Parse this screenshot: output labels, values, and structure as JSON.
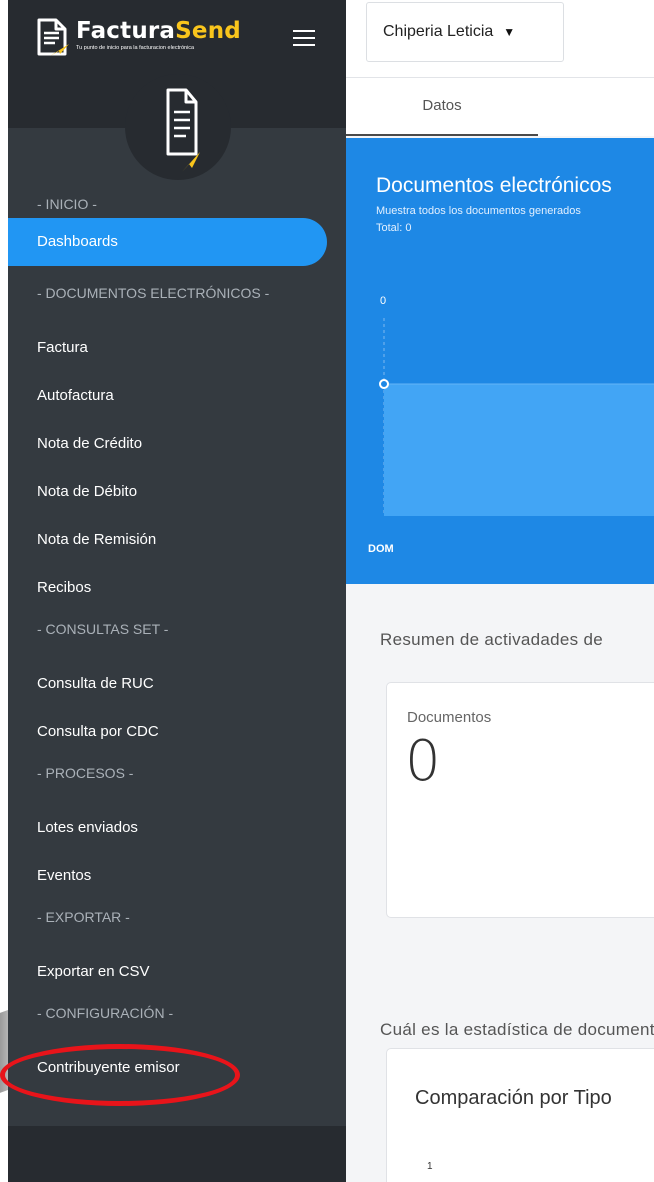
{
  "app": {
    "brand_part1": "Factura",
    "brand_part2": "Send",
    "tagline": "Tu punto de inicio para la facturacion electrónica",
    "brand_accent_color": "#f9c51c",
    "sidebar_bg": "#343a40",
    "active_color": "#2196f3"
  },
  "sidebar": {
    "sections": [
      {
        "header": "- INICIO -",
        "items": [
          {
            "label": "Dashboards",
            "active": true
          }
        ]
      },
      {
        "header": "- DOCUMENTOS ELECTRÓNICOS -",
        "items": [
          {
            "label": "Factura"
          },
          {
            "label": "Autofactura"
          },
          {
            "label": "Nota de Crédito"
          },
          {
            "label": "Nota de Débito"
          },
          {
            "label": "Nota de Remisión"
          },
          {
            "label": "Recibos"
          }
        ]
      },
      {
        "header": "- CONSULTAS SET -",
        "items": [
          {
            "label": "Consulta de RUC"
          },
          {
            "label": "Consulta por CDC"
          }
        ]
      },
      {
        "header": "- PROCESOS -",
        "items": [
          {
            "label": "Lotes enviados"
          },
          {
            "label": "Eventos"
          }
        ]
      },
      {
        "header": "- EXPORTAR -",
        "items": [
          {
            "label": "Exportar en CSV"
          }
        ]
      },
      {
        "header": "- CONFIGURACIÓN -",
        "items": [
          {
            "label": "Contribuyente emisor",
            "highlighted": true
          }
        ]
      }
    ]
  },
  "topbar": {
    "company": "Chiperia Leticia"
  },
  "tabs": [
    {
      "label": "Datos",
      "active": true
    }
  ],
  "documents_chart": {
    "title": "Documentos electrónicos",
    "subtitle": "Muestra todos los documentos generados",
    "total": "Total: 0",
    "bg_color": "#1e88e5",
    "chart_data": {
      "type": "area",
      "categories": [
        "DOM"
      ],
      "values": [
        0
      ],
      "ylim": [
        0,
        0
      ],
      "ytick_labels": [
        "0"
      ],
      "xtick_labels": [
        "DOM"
      ]
    }
  },
  "summary": {
    "heading": "Resumen de activadades de",
    "card_label": "Documentos",
    "card_value": "0"
  },
  "stats": {
    "heading": "Cuál es la estadística de documentos",
    "compare_title": "Comparación por Tipo",
    "compare_tick": "1"
  }
}
